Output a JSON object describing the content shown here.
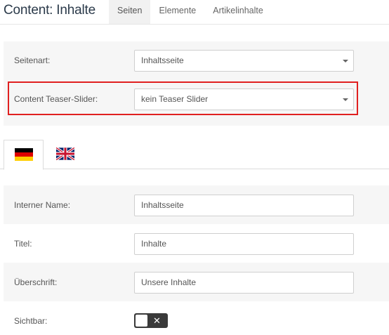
{
  "header": {
    "title": "Content: Inhalte",
    "tabs": [
      {
        "label": "Seiten",
        "active": true
      },
      {
        "label": "Elemente",
        "active": false
      },
      {
        "label": "Artikelinhalte",
        "active": false
      }
    ]
  },
  "settings": {
    "seitenart": {
      "label": "Seitenart:",
      "value": "Inhaltsseite"
    },
    "teaser_slider": {
      "label": "Content Teaser-Slider:",
      "value": "kein Teaser Slider"
    }
  },
  "languages": [
    {
      "name": "de-flag-icon",
      "active": true
    },
    {
      "name": "uk-flag-icon",
      "active": false
    }
  ],
  "fields": {
    "interner_name": {
      "label": "Interner Name:",
      "value": "Inhaltsseite"
    },
    "titel": {
      "label": "Titel:",
      "value": "Inhalte"
    },
    "ueberschrift": {
      "label": "Überschrift:",
      "value": "Unsere Inhalte"
    },
    "sichtbar": {
      "label": "Sichtbar:",
      "toggle_symbol": "✕",
      "checked": false
    }
  },
  "colors": {
    "highlight": "#e02020",
    "panel_bg": "#f6f6f6",
    "toggle_bg": "#3a3a3a"
  }
}
